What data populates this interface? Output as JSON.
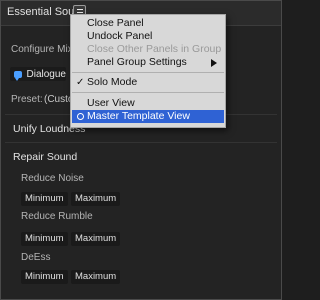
{
  "panel": {
    "tab_title": "Essential Sound",
    "menu_icon": "hamburger-menu-icon",
    "configure_label": "Configure Mix Ty",
    "dialogue_label": "Dialogue",
    "preset_label": "Preset:",
    "preset_value": "(Custo",
    "unify_loudness": "Unify Loudness",
    "repair_sound": "Repair Sound",
    "reduce_noise": "Reduce Noise",
    "reduce_rumble": "Reduce Rumble",
    "deess": "DeEss",
    "minimum": "Minimum",
    "maximum": "Maximum",
    "accent_color": "#4a9eff"
  },
  "context_menu": {
    "close_panel": "Close Panel",
    "undock_panel": "Undock Panel",
    "close_other_panels": "Close Other Panels in Group",
    "panel_group_settings": "Panel Group Settings",
    "solo_mode": "Solo Mode",
    "user_view": "User View",
    "master_template_view": "Master Template View",
    "check_symbol": "✓",
    "highlight_color": "#2f62d4"
  }
}
